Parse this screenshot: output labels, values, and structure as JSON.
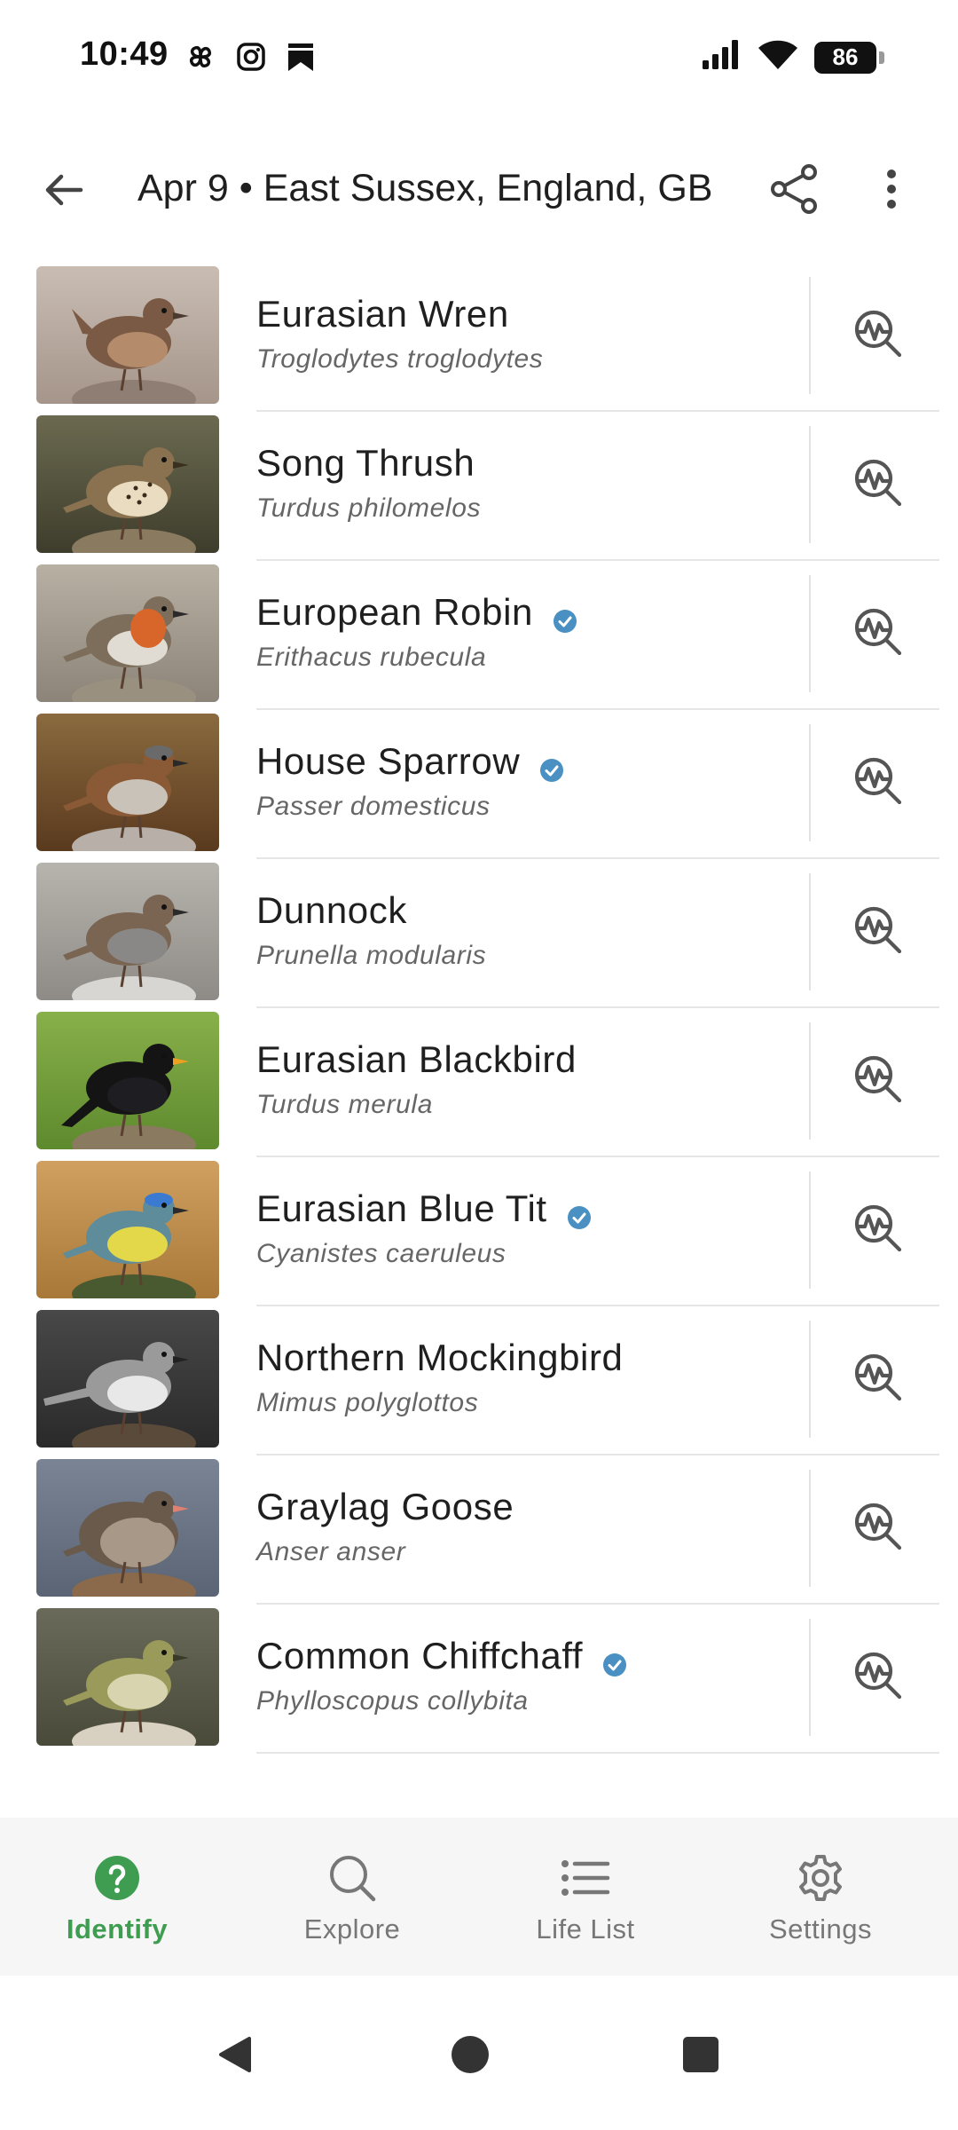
{
  "status_bar": {
    "time": "10:49",
    "battery": "86",
    "icons": [
      "pinwheel-icon",
      "instagram-icon",
      "bookmark-icon",
      "signal-icon",
      "wifi-icon",
      "battery-icon"
    ]
  },
  "app_bar": {
    "title": "Apr 9 • East Sussex, England, GB",
    "back_icon": "arrow-left-icon",
    "share_icon": "share-icon",
    "more_icon": "more-vertical-icon"
  },
  "colors": {
    "accent_green": "#3f9d52",
    "verified_blue": "#4a90c2"
  },
  "species": [
    {
      "common": "Eurasian Wren",
      "scientific": "Troglodytes troglodytes",
      "verified": false
    },
    {
      "common": "Song Thrush",
      "scientific": "Turdus philomelos",
      "verified": false
    },
    {
      "common": "European Robin",
      "scientific": "Erithacus rubecula",
      "verified": true
    },
    {
      "common": "House Sparrow",
      "scientific": "Passer domesticus",
      "verified": true
    },
    {
      "common": "Dunnock",
      "scientific": "Prunella modularis",
      "verified": false
    },
    {
      "common": "Eurasian Blackbird",
      "scientific": "Turdus merula",
      "verified": false
    },
    {
      "common": "Eurasian Blue Tit",
      "scientific": "Cyanistes caeruleus",
      "verified": true
    },
    {
      "common": "Northern Mockingbird",
      "scientific": "Mimus polyglottos",
      "verified": false
    },
    {
      "common": "Graylag Goose",
      "scientific": "Anser anser",
      "verified": false
    },
    {
      "common": "Common Chiffchaff",
      "scientific": "Phylloscopus collybita",
      "verified": true
    }
  ],
  "bottom_nav": [
    {
      "label": "Identify",
      "icon": "help-circle-icon",
      "active": true
    },
    {
      "label": "Explore",
      "icon": "search-icon",
      "active": false
    },
    {
      "label": "Life List",
      "icon": "list-icon",
      "active": false
    },
    {
      "label": "Settings",
      "icon": "gear-icon",
      "active": false
    }
  ],
  "system_nav": [
    "back-triangle-icon",
    "home-circle-icon",
    "recents-square-icon"
  ]
}
